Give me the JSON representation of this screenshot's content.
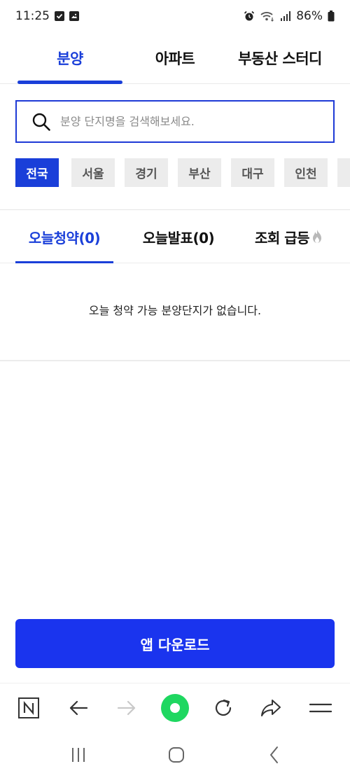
{
  "status_bar": {
    "time": "11:25",
    "battery": "86%"
  },
  "top_tabs": [
    {
      "label": "분양",
      "active": true
    },
    {
      "label": "아파트",
      "active": false
    },
    {
      "label": "부동산 스터디",
      "active": false
    }
  ],
  "search": {
    "placeholder": "분양 단지명을 검색해보세요."
  },
  "regions": [
    {
      "label": "전국",
      "active": true
    },
    {
      "label": "서울",
      "active": false
    },
    {
      "label": "경기",
      "active": false
    },
    {
      "label": "부산",
      "active": false
    },
    {
      "label": "대구",
      "active": false
    },
    {
      "label": "인천",
      "active": false
    }
  ],
  "sub_tabs": [
    {
      "label": "오늘청약(0)",
      "active": true
    },
    {
      "label": "오늘발표(0)",
      "active": false
    },
    {
      "label": "조회 급등",
      "active": false,
      "icon": "fire-icon"
    }
  ],
  "empty_message": "오늘 청약 가능 분양단지가 없습니다.",
  "download_button": "앱 다운로드",
  "colors": {
    "accent": "#1a3fd9",
    "download_button": "#1a34ee",
    "chip_bg": "#ececec",
    "toolbar_green": "#1ed760"
  },
  "browser_toolbar": {
    "icons": [
      "naver-n-icon",
      "back-arrow-icon",
      "forward-arrow-icon",
      "home-circle-icon",
      "refresh-icon",
      "share-icon",
      "menu-icon"
    ]
  },
  "android_nav": {
    "icons": [
      "recent-apps-icon",
      "home-icon",
      "back-icon"
    ]
  }
}
